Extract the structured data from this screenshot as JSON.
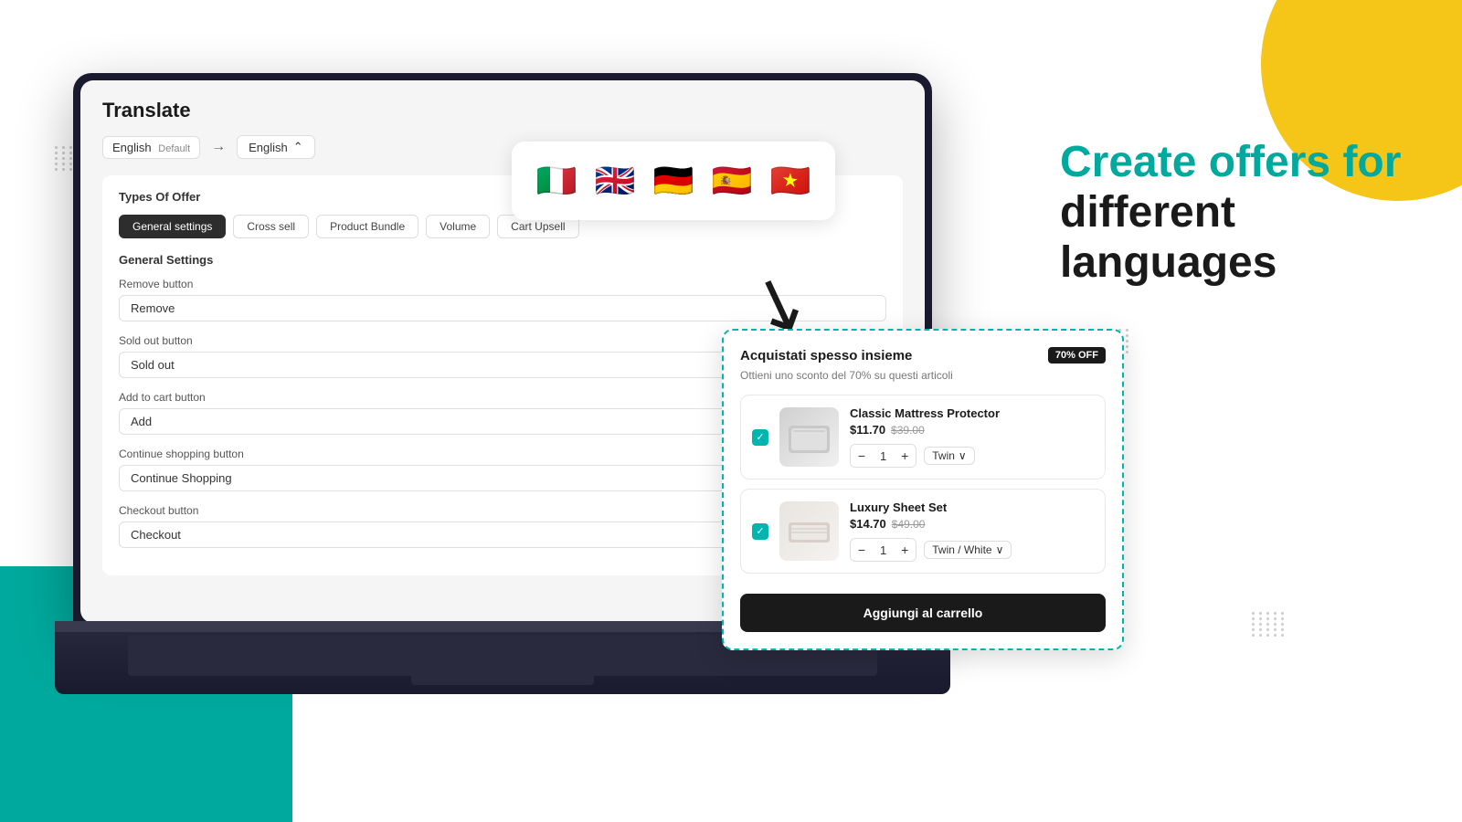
{
  "page": {
    "background": "#ffffff"
  },
  "app": {
    "title": "Translate",
    "source_lang": "English",
    "source_badge": "Default",
    "arrow": "→",
    "target_lang": "English",
    "types_title": "Types Of Offer",
    "tabs": [
      {
        "label": "General settings",
        "active": true
      },
      {
        "label": "Cross sell",
        "active": false
      },
      {
        "label": "Product Bundle",
        "active": false
      },
      {
        "label": "Volume",
        "active": false
      },
      {
        "label": "Cart Upsell",
        "active": false
      }
    ],
    "general_settings_title": "General Settings",
    "fields": [
      {
        "label": "Remove button",
        "value": "Remove"
      },
      {
        "label": "Sold out button",
        "value": "Sold out"
      },
      {
        "label": "Add to cart button",
        "value": "Add"
      },
      {
        "label": "Continue shopping button",
        "value": "Continue Shopping"
      },
      {
        "label": "Checkout button",
        "value": "Checkout"
      }
    ]
  },
  "flags": [
    "🇮🇹",
    "🇬🇧",
    "🇩🇪",
    "🇪🇸",
    "🇻🇳"
  ],
  "widget": {
    "title": "Acquistati spesso insieme",
    "discount": "70% OFF",
    "subtitle": "Ottieni uno sconto del 70% su questi articoli",
    "products": [
      {
        "name": "Classic Mattress Protector",
        "price": "$11.70",
        "original": "$39.00",
        "qty": 1,
        "variant": "Twin",
        "checked": true
      },
      {
        "name": "Luxury Sheet Set",
        "price": "$14.70",
        "original": "$49.00",
        "qty": 1,
        "variant": "Twin / White",
        "checked": true
      }
    ],
    "cta": "Aggiungi al carrello"
  },
  "headline": {
    "line1": "Create offers for",
    "line2": "different",
    "line3": "languages"
  }
}
